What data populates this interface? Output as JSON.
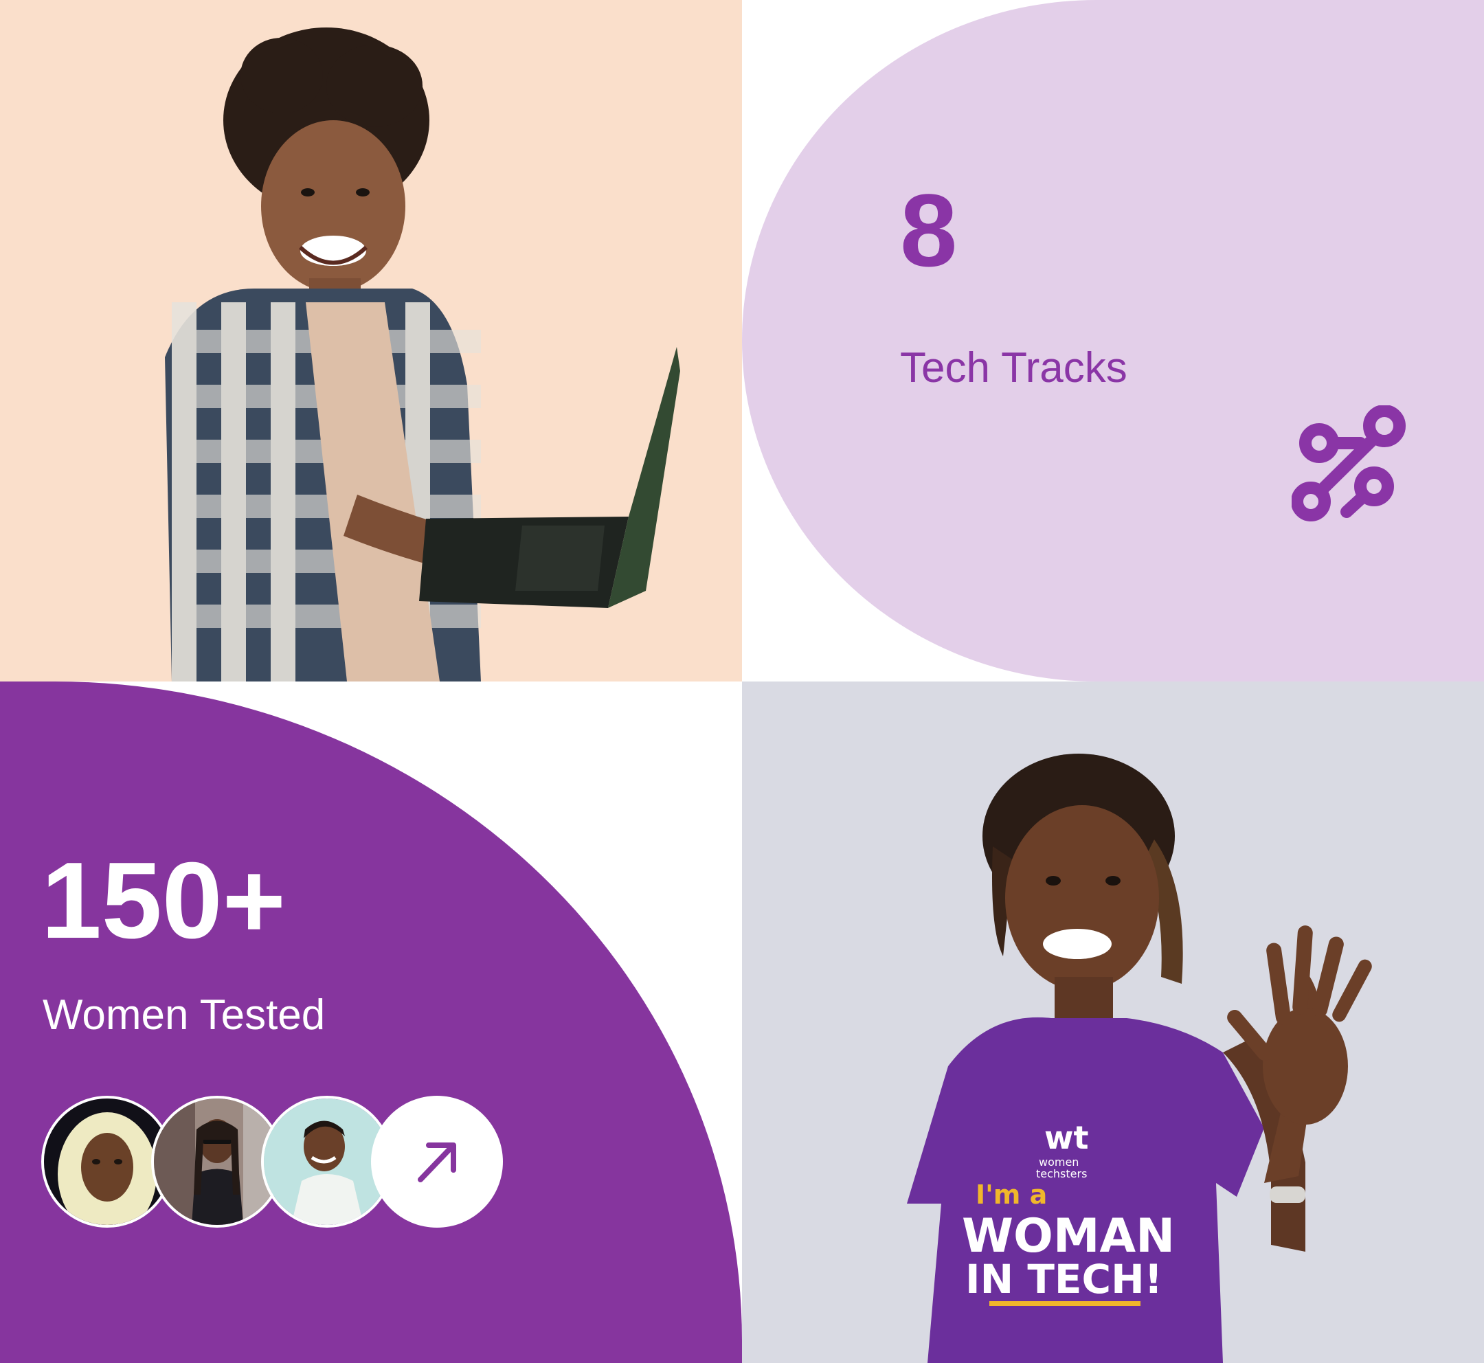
{
  "stats": {
    "tracks": {
      "value": "8",
      "label": "Tech Tracks",
      "icon": "git-branch-icon"
    },
    "women": {
      "value": "150+",
      "label": "Women Tested",
      "icon": "arrow-up-right-icon"
    }
  },
  "photos": {
    "top_left": "woman-with-laptop-photo",
    "bottom_right": "woman-waving-photo",
    "tshirt_text": [
      "wt",
      "women",
      "techsters",
      "I'm a",
      "WOMAN",
      "IN TECH!"
    ]
  },
  "avatars": [
    "avatar-hijab",
    "avatar-braids-sunglasses",
    "avatar-short-hair"
  ],
  "colors": {
    "peach": "#fadfcb",
    "lilac": "#e3cfe9",
    "purple": "#86359e",
    "accent_text": "#8a35a6",
    "grey_bg": "#d9dae3"
  }
}
